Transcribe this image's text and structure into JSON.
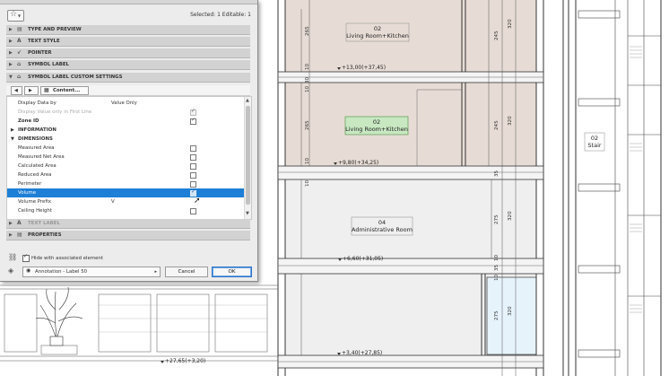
{
  "dialog": {
    "selection_info": "Selected: 1 Editable: 1",
    "panels": [
      {
        "label": "TYPE AND PREVIEW",
        "icon": "preview-icon"
      },
      {
        "label": "TEXT STYLE",
        "icon": "text-style-icon"
      },
      {
        "label": "POINTER",
        "icon": "pointer-icon"
      },
      {
        "label": "SYMBOL LABEL",
        "icon": "symbol-label-icon"
      },
      {
        "label": "SYMBOL LABEL CUSTOM SETTINGS",
        "icon": "custom-settings-icon"
      }
    ],
    "content_dropdown": "Content...",
    "rows": {
      "display_data_by": {
        "label": "Display Data by",
        "value": "Value Only"
      },
      "display_first_line": {
        "label": "Display Value only in First Line",
        "checked": true
      },
      "zone_id": {
        "label": "Zone ID",
        "checked": true
      },
      "information": {
        "label": "INFORMATION"
      },
      "dimensions": {
        "label": "DIMENSIONS"
      },
      "measured_area": {
        "label": "Measured Area",
        "checked": false
      },
      "measured_net_area": {
        "label": "Measured Net Area",
        "checked": false
      },
      "calculated_area": {
        "label": "Calculated Area",
        "checked": false
      },
      "reduced_area": {
        "label": "Reduced Area",
        "checked": false
      },
      "perimeter": {
        "label": "Perimeter",
        "checked": false
      },
      "volume": {
        "label": "Volume",
        "checked": true
      },
      "volume_prefix": {
        "label": "Volume Prefix",
        "value": "V"
      },
      "ceiling_height": {
        "label": "Ceiling Height",
        "checked": false
      }
    },
    "text_label": "TEXT LABEL",
    "properties": "PROPERTIES",
    "hide_with_element": "Hide with associated element",
    "layer": "Annotation - Label 50",
    "cancel": "Cancel",
    "ok": "OK"
  },
  "drawing": {
    "rooms": [
      {
        "number": "02",
        "name": "Living Room+Kitchen"
      },
      {
        "number": "02",
        "name": "Living Room+Kitchen"
      },
      {
        "number": "04",
        "name": "Administrative Room"
      },
      {
        "number": "02",
        "name": "Stair"
      }
    ],
    "level_markers": [
      "+13,00(+37,45)",
      "+9,80(+34,25)",
      "+6,60(+31,05)",
      "+3,40(+27,85)",
      "+27,65(+3,20)"
    ],
    "dims": [
      "265",
      "245",
      "320",
      "10",
      "30",
      "10",
      "265",
      "245",
      "320",
      "10",
      "35",
      "10",
      "275",
      "320",
      "10",
      "35",
      "10",
      "275",
      "320"
    ],
    "colors": {
      "room_fill": "#e7dcd5",
      "selected_label": "#c8e8c2",
      "glass_fill": "#e6f3fb"
    }
  }
}
